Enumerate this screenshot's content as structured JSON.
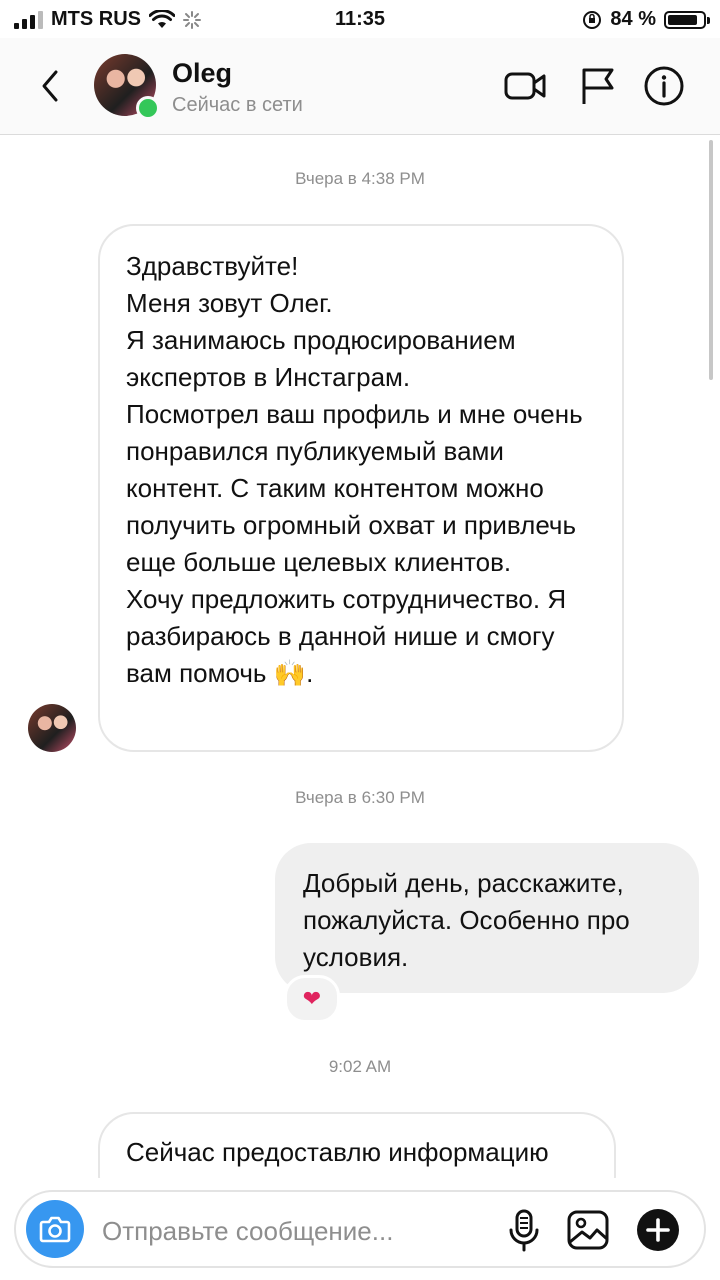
{
  "status_bar": {
    "carrier": "MTS RUS",
    "time": "11:35",
    "battery": "84 %",
    "battery_level": 0.84
  },
  "header": {
    "name": "Oleg",
    "status": "Сейчас в сети"
  },
  "messages": [
    {
      "timestamp": "Вчера в 4:38 PM",
      "direction": "incoming",
      "paragraphs": [
        "Здравствуйте!",
        "Меня зовут Олег.",
        "Я занимаюсь продюсированием экспертов в Инстаграм.",
        "Посмотрел ваш профиль и мне очень понравился публикуемый вами контент. С таким контентом можно получить огромный охват и привлечь еще больше целевых клиентов.",
        "Хочу предложить сотрудничество. Я разбираюсь в данной нише и смогу вам помочь 🙌."
      ]
    },
    {
      "timestamp": "Вчера в 6:30 PM",
      "direction": "outgoing",
      "text": "Добрый день, расскажите, пожалуйста. Особенно про условия.",
      "reaction": "❤"
    },
    {
      "timestamp": "9:02 AM",
      "direction": "incoming",
      "text": "Сейчас предоставлю информацию"
    }
  ],
  "composer": {
    "placeholder": "Отправьте сообщение..."
  },
  "icons": {
    "back": "chevron-left-icon",
    "video": "video-camera-icon",
    "report": "flag-icon",
    "info": "info-icon",
    "camera": "camera-icon",
    "mic": "microphone-icon",
    "gallery": "image-icon",
    "more": "plus-icon"
  },
  "colors": {
    "accent": "#3797f0",
    "online": "#34c759",
    "reaction": "#e0245e"
  }
}
